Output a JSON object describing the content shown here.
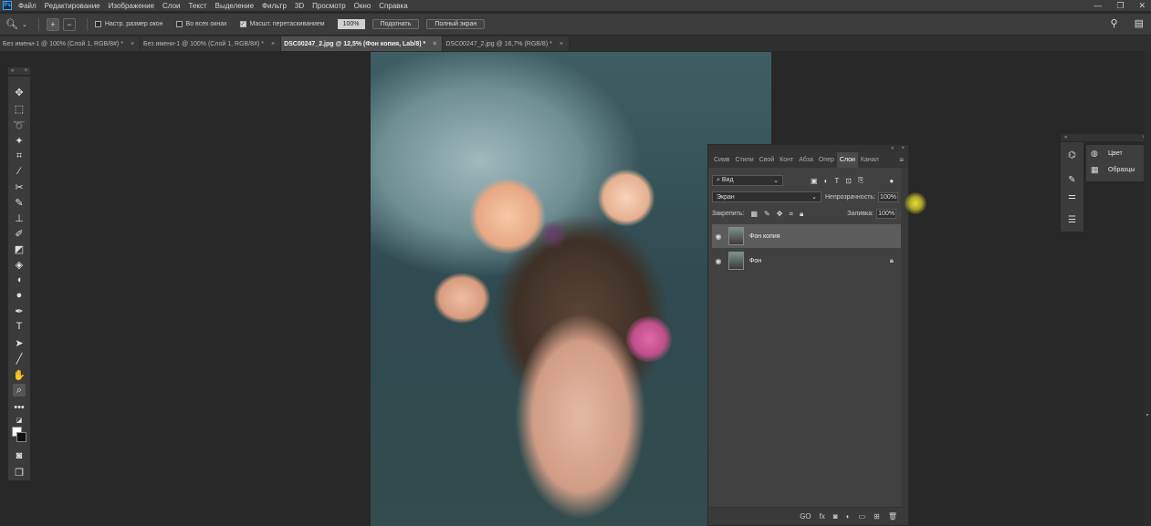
{
  "app": {
    "logo_text": "Ps"
  },
  "menu": [
    "Файл",
    "Редактирование",
    "Изображение",
    "Слои",
    "Текст",
    "Выделение",
    "Фильтр",
    "3D",
    "Просмотр",
    "Окно",
    "Справка"
  ],
  "window_controls": {
    "minimize": "—",
    "restore": "❐",
    "close": "✕"
  },
  "options_bar": {
    "tool_icon": "zoom-icon",
    "checkbox_resize": "Настр. размер окон",
    "checkbox_all_windows": "Во всех окнах",
    "checkbox_scrubby": "Масшт. перетаскиванием",
    "zoom_value": "100%",
    "fit_button": "Подогнать",
    "fullscreen_button": "Полный экран"
  },
  "tabs": [
    {
      "label": "Без имени-1 @ 100% (Слой 1, RGB/8#) *",
      "active": false
    },
    {
      "label": "Без имени-1 @ 100% (Слой 1, RGB/8#) *",
      "active": false
    },
    {
      "label": "DSC00247_2.jpg @ 12,5% (Фон копия, Lab/8) *",
      "active": true
    },
    {
      "label": "DSC00247_2.jpg @ 16,7% (RGB/8) *",
      "active": false
    }
  ],
  "tab_close": "×",
  "toolbar_head": {
    "collapse": "»",
    "close": "×"
  },
  "layers_panel": {
    "tabs": [
      "Симв",
      "Стили",
      "Свой",
      "Конт",
      "Абза",
      "Опер",
      "Слои",
      "Канал"
    ],
    "active_tab": "Слои",
    "filter_label": "Вид",
    "blend_mode": "Экран",
    "opacity_label": "Непрозрачность:",
    "opacity_value": "100%",
    "lock_label": "Закрепить:",
    "fill_label": "Заливка:",
    "fill_value": "100%",
    "layers": [
      {
        "name": "Фон копия",
        "selected": true,
        "locked": false
      },
      {
        "name": "Фон",
        "selected": false,
        "locked": true
      }
    ],
    "bottom_link": "GO",
    "bottom_fx": "fx"
  },
  "right_panels": {
    "items": [
      {
        "label": "Цвет",
        "icon": "palette-icon"
      },
      {
        "label": "Образцы",
        "icon": "swatches-icon"
      }
    ]
  },
  "colors": {
    "accent": "#31a8ff",
    "ui_bg": "#282828",
    "panel": "#414141",
    "cursor_highlight": "#f0e040"
  }
}
